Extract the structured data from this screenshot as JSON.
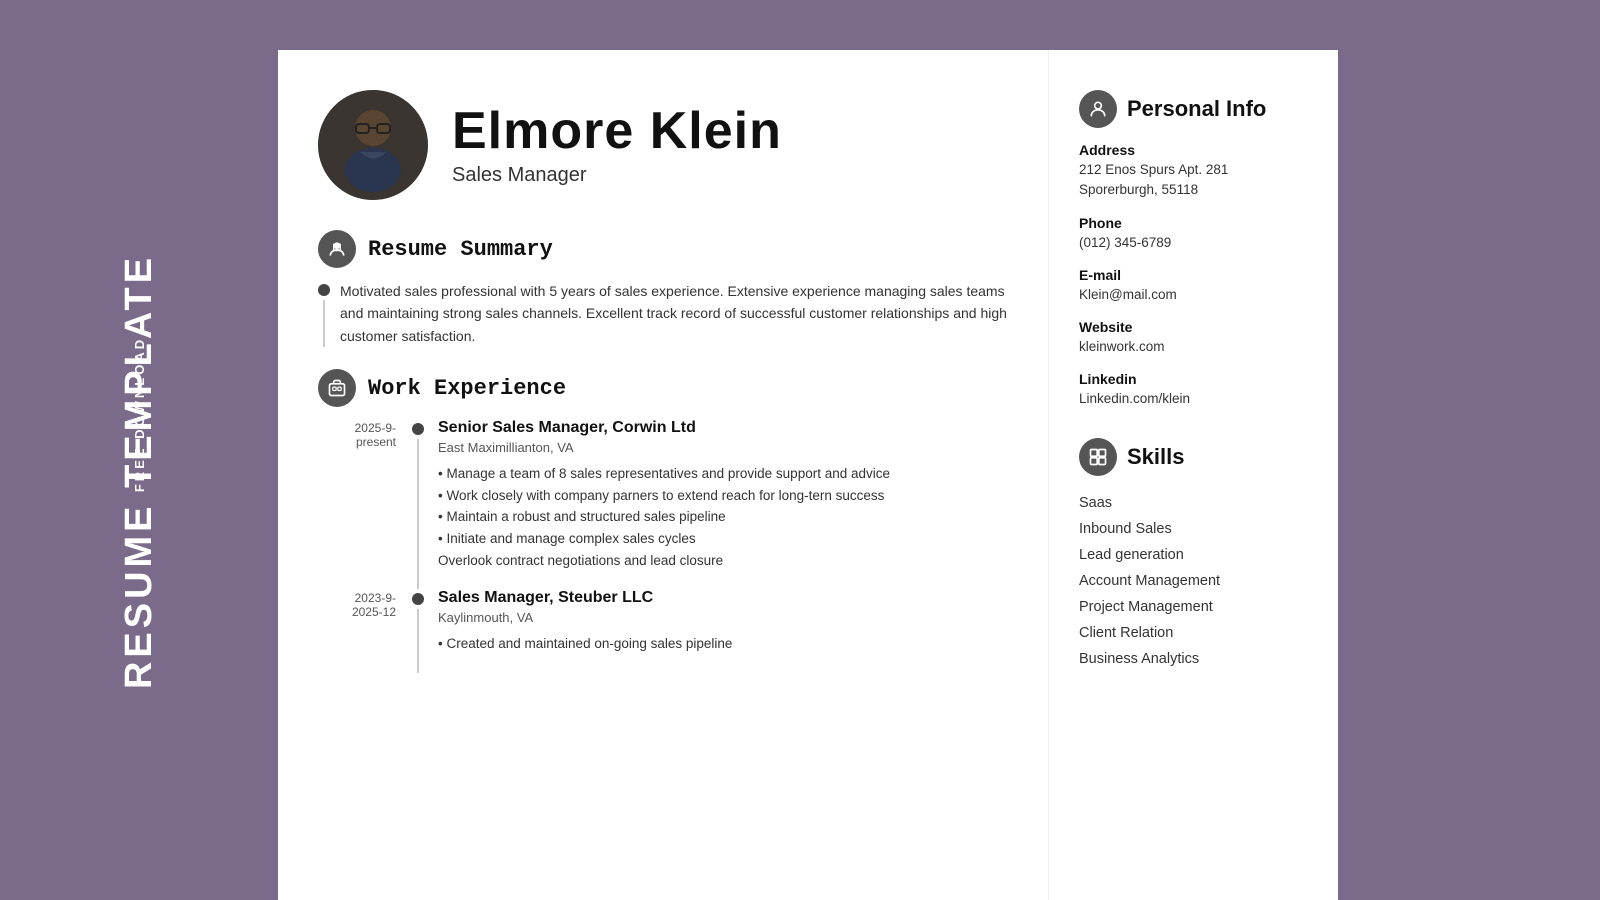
{
  "sidebar": {
    "free_download": "FREE DOWNLOAD",
    "resume_template": "RESUME TEMPLATE"
  },
  "header": {
    "name": "Elmore Klein",
    "job_title": "Sales Manager"
  },
  "resume_summary": {
    "section_title": "Resume Summary",
    "text": "Motivated sales professional with 5 years of sales experience. Extensive experience managing sales teams and maintaining strong sales channels. Excellent track record of successful customer relationships and high customer satisfaction."
  },
  "work_experience": {
    "section_title": "Work Experience",
    "jobs": [
      {
        "date": "2025-9-present",
        "title": "Senior Sales Manager, Corwin Ltd",
        "location": "East Maximillianton, VA",
        "bullets": [
          "• Manage a team of 8 sales representatives and provide support and advice",
          "• Work closely with company parners to extend reach for long-tern success",
          "• Maintain a robust and structured sales pipeline",
          "• Initiate and manage complex sales cycles",
          "Overlook contract negotiations and lead closure"
        ]
      },
      {
        "date": "2023-9-\n2025-12",
        "title": "Sales Manager, Steuber LLC",
        "location": "Kaylinmouth, VA",
        "bullets": [
          "• Created and maintained on-going sales pipeline"
        ]
      }
    ]
  },
  "personal_info": {
    "section_title": "Personal Info",
    "address_label": "Address",
    "address_line1": "212 Enos Spurs Apt. 281",
    "address_line2": "Sporerburgh, 55118",
    "phone_label": "Phone",
    "phone": "(012) 345-6789",
    "email_label": "E-mail",
    "email": "Klein@mail.com",
    "website_label": "Website",
    "website": "kleinwork.com",
    "linkedin_label": "Linkedin",
    "linkedin": "Linkedin.com/klein"
  },
  "skills": {
    "section_title": "Skills",
    "items": [
      "Saas",
      "Inbound Sales",
      "Lead generation",
      "Account Management",
      "Project Management",
      "Client Relation",
      "Business Analytics"
    ]
  }
}
